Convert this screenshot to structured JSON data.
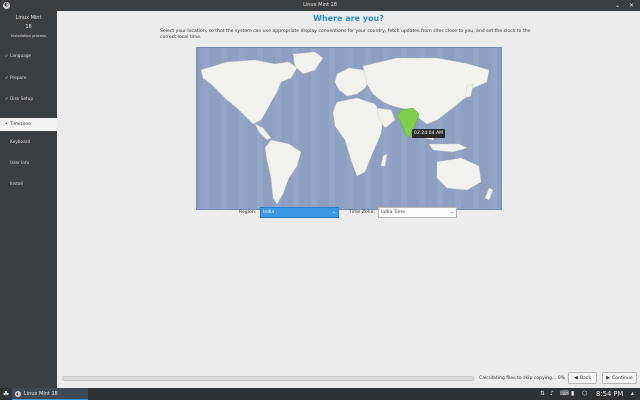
{
  "window": {
    "title": "Linux Mint 18",
    "logo_glyph": "◐",
    "minimize_glyph": "⌄",
    "close_glyph": "✕"
  },
  "sidebar": {
    "title": "Linux Mint",
    "version": "18",
    "subtitle": "Installation process",
    "items": [
      {
        "label": "Language",
        "mark": "✓"
      },
      {
        "label": "Prepare",
        "mark": "✓"
      },
      {
        "label": "Disk Setup",
        "mark": "✓"
      },
      {
        "label": "Timezone",
        "mark": "•"
      },
      {
        "label": "Keyboard",
        "mark": ""
      },
      {
        "label": "User Info",
        "mark": ""
      },
      {
        "label": "Install",
        "mark": ""
      }
    ]
  },
  "page": {
    "heading": "Where are you?",
    "description": "Select your location, so that the system can use appropriate display conventions for your country, fetch updates from sites close to you, and set the clock to the correct local time.",
    "map_time": "02:24:04 AM",
    "region_label": "Region:",
    "region_value": "India",
    "timezone_label": "Time Zone:",
    "timezone_value": "India Time"
  },
  "footer": {
    "progress_text": "Calculating files to skip copying... 0%",
    "progress_fraction": 0.0,
    "back_label": "Back",
    "continue_label": "Continue"
  },
  "taskbar": {
    "menu_glyph": "☘",
    "task_label": "Linux Mint 18",
    "tray_icons": [
      "network-icon",
      "volume-icon",
      "keyboard-icon",
      "battery-icon",
      "updates-icon"
    ],
    "clock": "8:54 PM",
    "show_more_glyph": "▴"
  },
  "colors": {
    "accent": "#3c9ae3",
    "heading": "#2a8ad4",
    "sidebar_bg": "#3b3f42",
    "map_ocean": "#8ea0c1",
    "highlight_country": "#7fcf4a"
  }
}
